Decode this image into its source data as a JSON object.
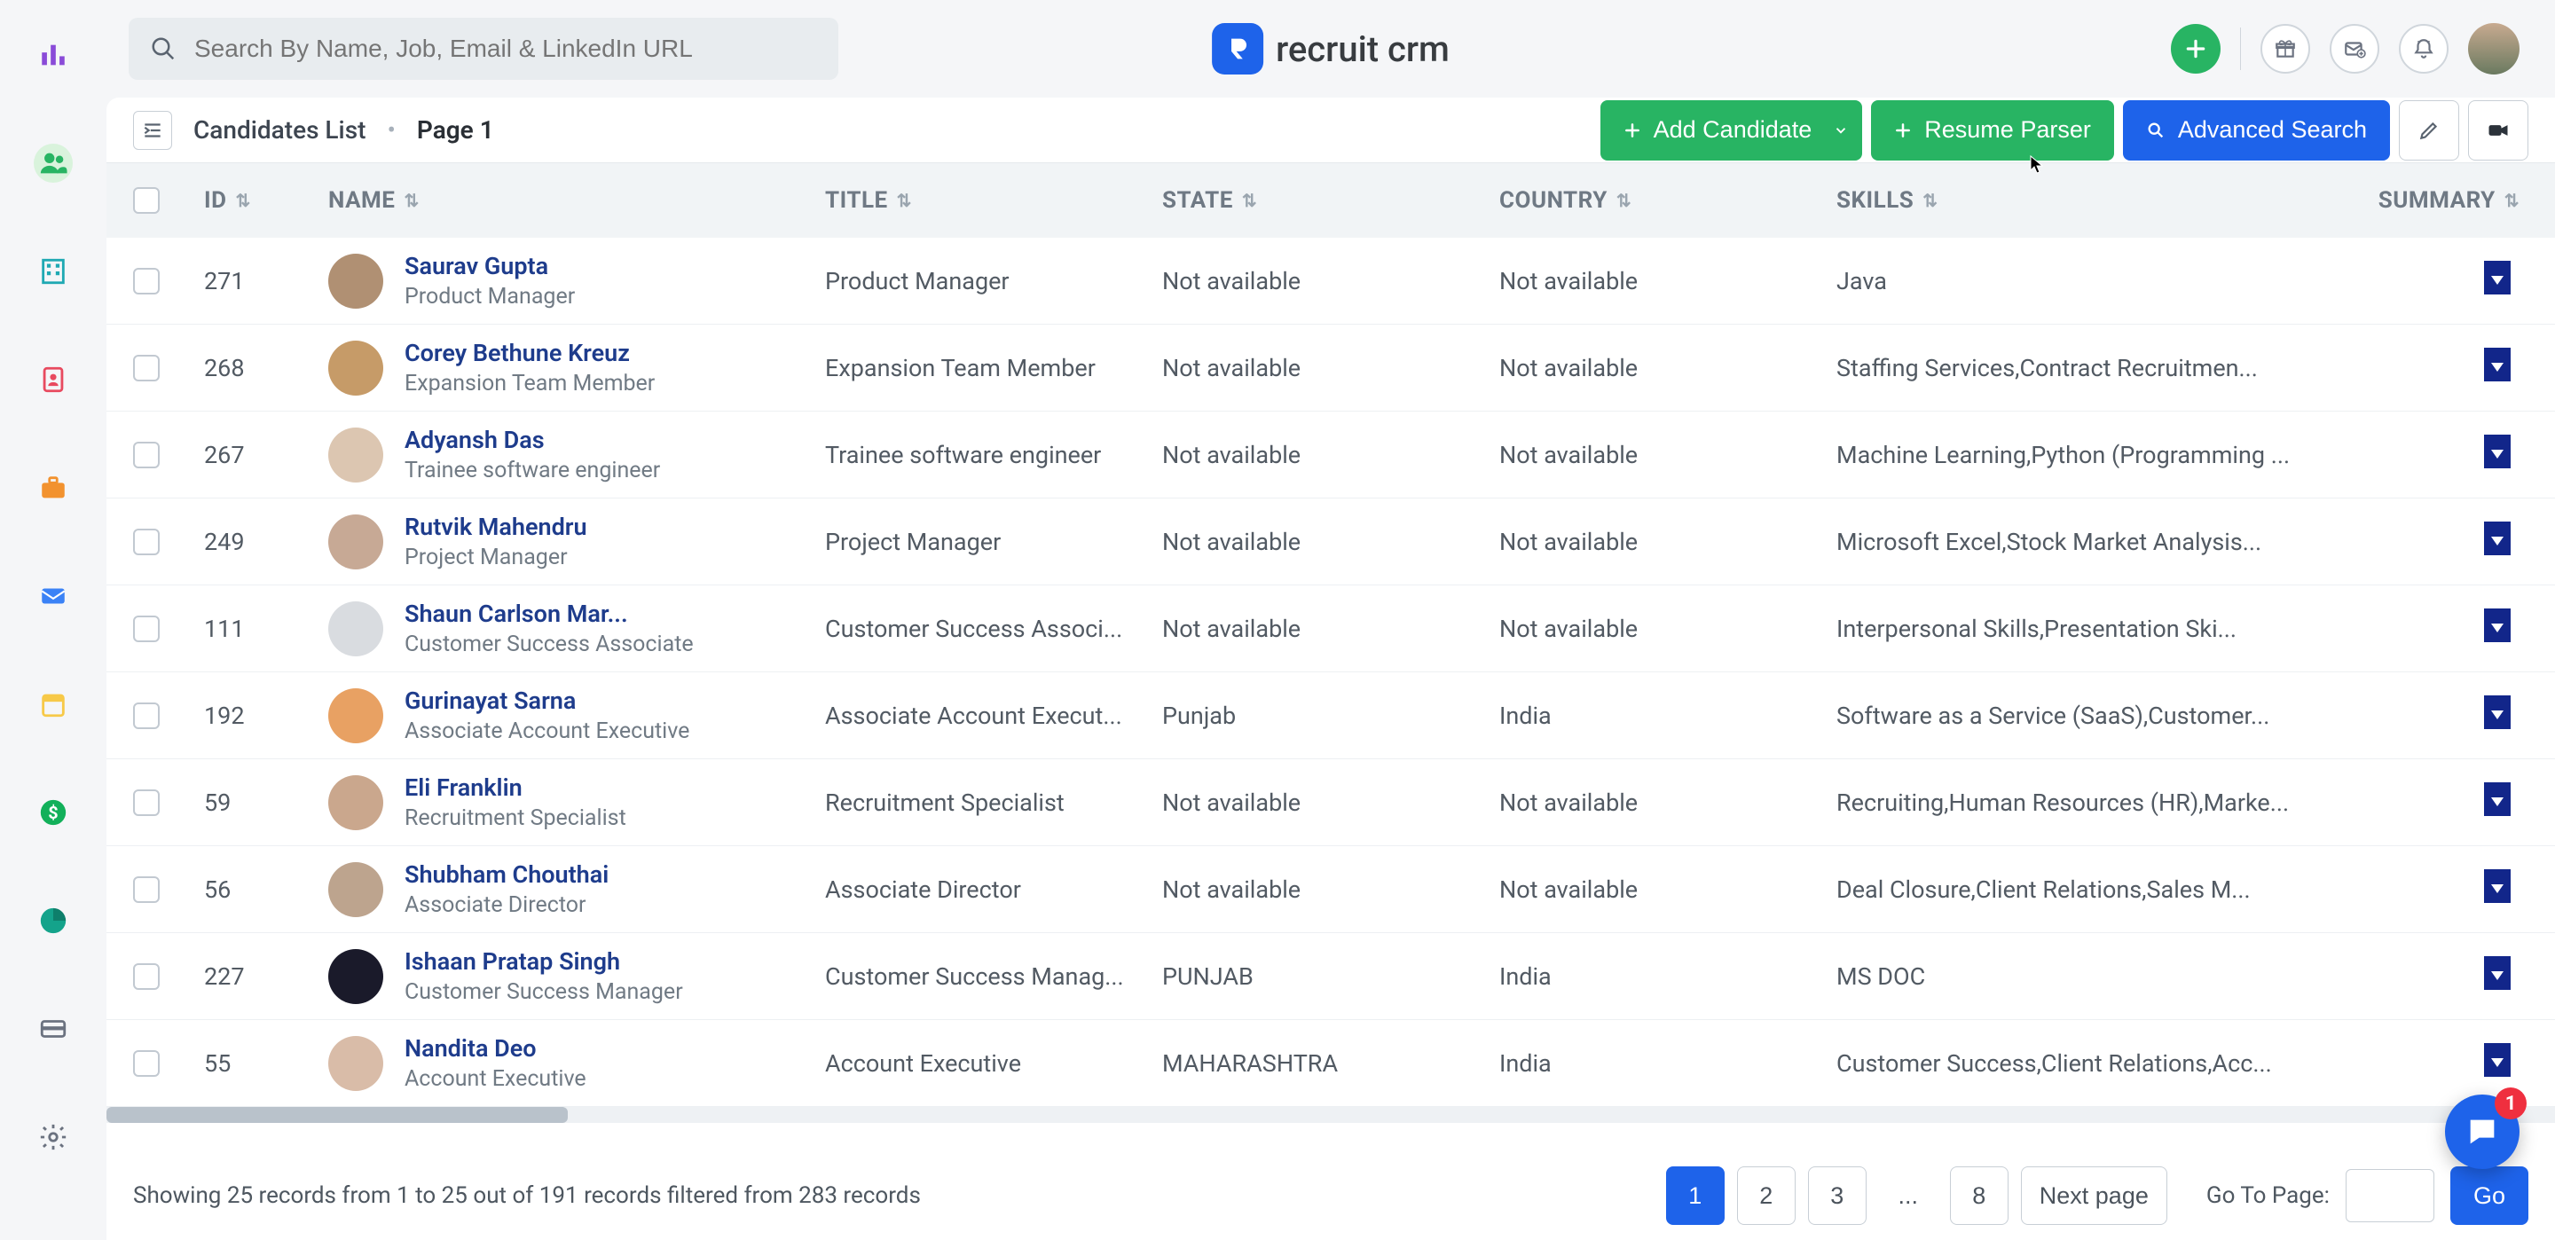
{
  "search": {
    "placeholder": "Search By Name, Job, Email & LinkedIn URL"
  },
  "brand": {
    "name": "recruit crm"
  },
  "sidebar": {
    "items": [
      {
        "name": "analytics",
        "color": "#8a4bd8"
      },
      {
        "name": "candidates",
        "color": "#28b463",
        "active": true
      },
      {
        "name": "companies",
        "color": "#1fa9b3"
      },
      {
        "name": "contacts",
        "color": "#e84a5f"
      },
      {
        "name": "jobs",
        "color": "#f2922f"
      },
      {
        "name": "mail",
        "color": "#3b82f6"
      },
      {
        "name": "calendar",
        "color": "#f7c948"
      },
      {
        "name": "deals",
        "color": "#12b05a"
      },
      {
        "name": "reports",
        "color": "#14a38b"
      },
      {
        "name": "billing",
        "color": "#6b7280"
      },
      {
        "name": "settings",
        "color": "#6b7280"
      }
    ]
  },
  "page": {
    "title": "Candidates List",
    "page_label": "Page 1",
    "actions": {
      "add": "Add Candidate",
      "parser": "Resume Parser",
      "advanced": "Advanced Search"
    }
  },
  "table": {
    "headers": {
      "id": "ID",
      "name": "NAME",
      "title": "TITLE",
      "state": "STATE",
      "country": "COUNTRY",
      "skills": "SKILLS",
      "summary": "SUMMARY"
    },
    "rows": [
      {
        "id": "271",
        "name": "Saurav Gupta",
        "role": "Product Manager",
        "title": "Product Manager",
        "state": "Not available",
        "country": "Not available",
        "skills": "Java",
        "av": "#b09073"
      },
      {
        "id": "268",
        "name": "Corey Bethune Kreuz",
        "role": "Expansion Team Member",
        "title": "Expansion Team Member",
        "state": "Not available",
        "country": "Not available",
        "skills": "Staffing Services,Contract Recruitmen...",
        "av": "#c69b68"
      },
      {
        "id": "267",
        "name": "Adyansh Das",
        "role": "Trainee software engineer",
        "title": "Trainee software engineer",
        "state": "Not available",
        "country": "Not available",
        "skills": "Machine Learning,Python (Programming ...",
        "av": "#dcc6b1"
      },
      {
        "id": "249",
        "name": "Rutvik Mahendru",
        "role": "Project Manager",
        "title": "Project Manager",
        "state": "Not available",
        "country": "Not available",
        "skills": "Microsoft Excel,Stock Market Analysis...",
        "av": "#c7a995"
      },
      {
        "id": "111",
        "name": "Shaun Carlson Mar...",
        "role": "Customer Success Associate",
        "title": "Customer Success Associ...",
        "state": "Not available",
        "country": "Not available",
        "skills": "Interpersonal Skills,Presentation Ski...",
        "av": "#d9dce0"
      },
      {
        "id": "192",
        "name": "Gurinayat Sarna",
        "role": "Associate Account Executive",
        "title": "Associate Account Execut...",
        "state": "Punjab",
        "country": "India",
        "skills": "Software as a Service (SaaS),Customer...",
        "av": "#e8a163"
      },
      {
        "id": "59",
        "name": "Eli Franklin",
        "role": "Recruitment Specialist",
        "title": "Recruitment Specialist",
        "state": "Not available",
        "country": "Not available",
        "skills": "Recruiting,Human Resources (HR),Marke...",
        "av": "#caa78d"
      },
      {
        "id": "56",
        "name": "Shubham Chouthai",
        "role": "Associate Director",
        "title": "Associate Director",
        "state": "Not available",
        "country": "Not available",
        "skills": "Deal Closure,Client Relations,Sales M...",
        "av": "#bda48e"
      },
      {
        "id": "227",
        "name": "Ishaan Pratap Singh",
        "role": "Customer Success Manager",
        "title": "Customer Success Manag...",
        "state": "PUNJAB",
        "country": "India",
        "skills": "MS DOC",
        "av": "#1a1a2a"
      },
      {
        "id": "55",
        "name": "Nandita Deo",
        "role": "Account Executive",
        "title": "Account Executive",
        "state": "MAHARASHTRA",
        "country": "India",
        "skills": "Customer Success,Client Relations,Acc...",
        "av": "#d9bca8"
      }
    ]
  },
  "footer": {
    "summary": "Showing 25 records from 1 to 25 out of 191 records filtered from 283 records",
    "pages": [
      "1",
      "2",
      "3",
      "...",
      "8"
    ],
    "next": "Next page",
    "goto_label": "Go To Page:",
    "go": "Go"
  },
  "chat": {
    "badge": "1"
  }
}
